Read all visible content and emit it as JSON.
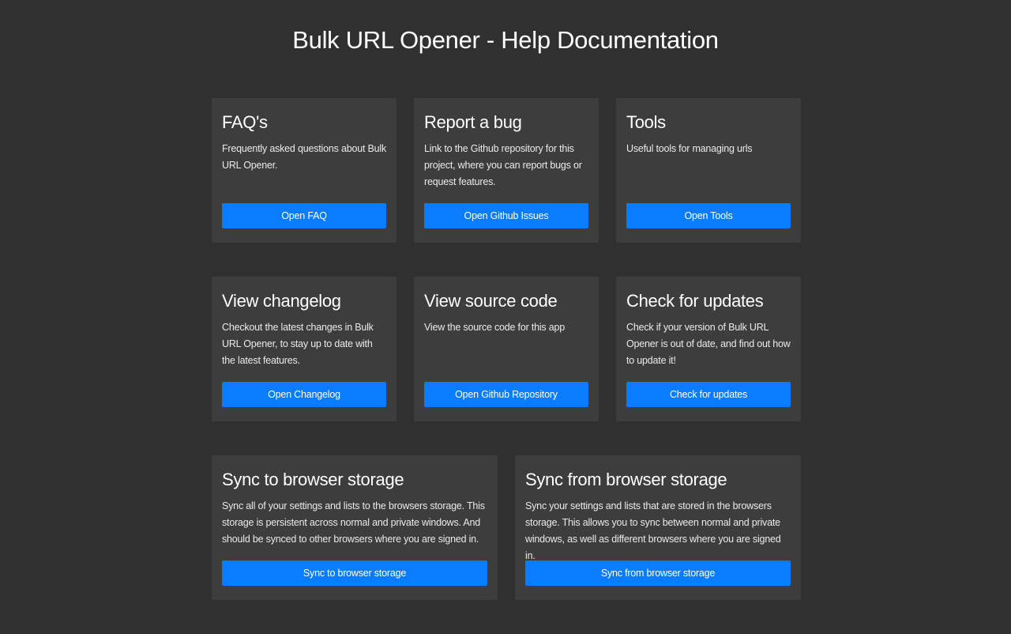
{
  "page": {
    "title": "Bulk URL Opener - Help Documentation"
  },
  "cards": [
    {
      "title": "FAQ's",
      "description": "Frequently asked questions about Bulk URL Opener.",
      "button": "Open FAQ"
    },
    {
      "title": "Report a bug",
      "description": "Link to the Github repository for this project, where you can report bugs or request features.",
      "button": "Open Github Issues"
    },
    {
      "title": "Tools",
      "description": "Useful tools for managing urls",
      "button": "Open Tools"
    },
    {
      "title": "View changelog",
      "description": "Checkout the latest changes in Bulk URL Opener, to stay up to date with the latest features.",
      "button": "Open Changelog"
    },
    {
      "title": "View source code",
      "description": "View the source code for this app",
      "button": "Open Github Repository"
    },
    {
      "title": "Check for updates",
      "description": "Check if your version of Bulk URL Opener is out of date, and find out how to update it!",
      "button": "Check for updates"
    },
    {
      "title": "Sync to browser storage",
      "description": "Sync all of your settings and lists to the browsers storage. This storage is persistent across normal and private windows. And should be synced to other browsers where you are signed in.",
      "button": "Sync to browser storage"
    },
    {
      "title": "Sync from browser storage",
      "description": "Sync your settings and lists that are stored in the browsers storage. This allows you to sync between normal and private windows, as well as different browsers where you are signed in.",
      "button": "Sync from browser storage"
    }
  ],
  "colors": {
    "background": "#303030",
    "card": "#3d3d3d",
    "accent": "#0a7cff"
  }
}
